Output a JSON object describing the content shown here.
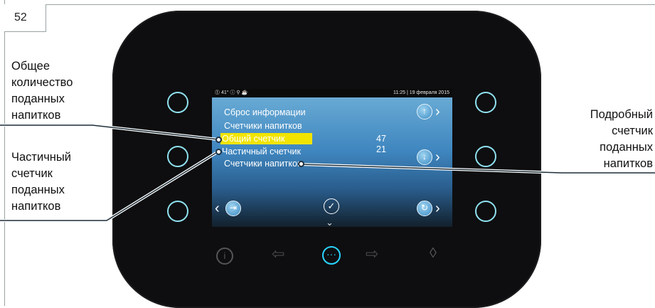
{
  "page_number": "52",
  "status_bar": {
    "left": "⓵ 41° ⓘ  ⚲ ☕",
    "right": "11:25 | 19 февраля 2015"
  },
  "screen": {
    "line1": "Сброс информации",
    "line2": "Счетчики напитков",
    "line3": "Общий счетчик",
    "line3_value": "47",
    "line4": "Частичный счетчик",
    "line4_value": "21",
    "line5": "Счетчики напитков"
  },
  "callouts": {
    "total_line1": "Общее",
    "total_line2": "количество",
    "total_line3": "поданных",
    "total_line4": "напитков",
    "partial_line1": "Частичный",
    "partial_line2": "счетчик",
    "partial_line3": "поданных",
    "partial_line4": "напитков",
    "detailed_line1": "Подробный",
    "detailed_line2": "счетчик",
    "detailed_line3": "поданных",
    "detailed_line4": "напитков"
  },
  "colors": {
    "highlight": "#f2e400",
    "ring": "#8fe2f0",
    "menu_accent": "#2ad4ff"
  },
  "icons": {
    "screen_up": "arrow-up-icon",
    "screen_down": "arrow-down-icon",
    "screen_refresh": "refresh-icon",
    "screen_exit": "exit-icon",
    "screen_ok": "check-icon",
    "bottom": [
      "info-icon",
      "arrow-left-icon",
      "menu-dots-icon",
      "arrow-right-icon",
      "drop-icon"
    ]
  }
}
